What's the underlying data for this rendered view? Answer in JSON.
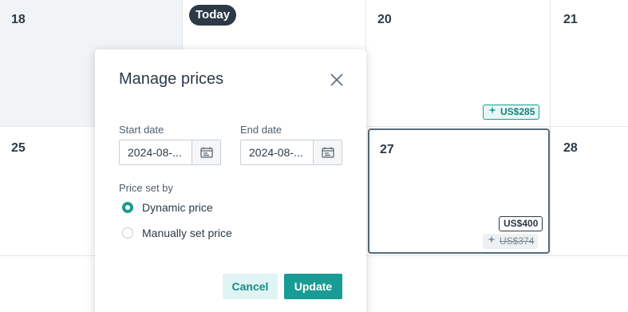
{
  "calendar": {
    "week1": {
      "d18": "18",
      "d20": "20",
      "d21": "21",
      "today_label": "Today"
    },
    "week2": {
      "d25": "25",
      "d27": "27",
      "d28": "28"
    },
    "prices": {
      "dynamic_20": "US$285",
      "manual_27": "US$400",
      "old_27": "US$374"
    }
  },
  "modal": {
    "title": "Manage prices",
    "start_date": {
      "label": "Start date",
      "value": "2024-08-..."
    },
    "end_date": {
      "label": "End date",
      "value": "2024-08-..."
    },
    "price_set_by": {
      "label": "Price set by",
      "options": [
        {
          "label": "Dynamic price",
          "selected": true
        },
        {
          "label": "Manually set price",
          "selected": false
        }
      ]
    },
    "cancel_label": "Cancel",
    "update_label": "Update"
  },
  "colors": {
    "accent": "#1a9c96",
    "dark": "#2c3a47",
    "past_bg": "#f1f4f6"
  },
  "icons": [
    "sparkle-icon",
    "close-icon",
    "calendar-icon"
  ]
}
